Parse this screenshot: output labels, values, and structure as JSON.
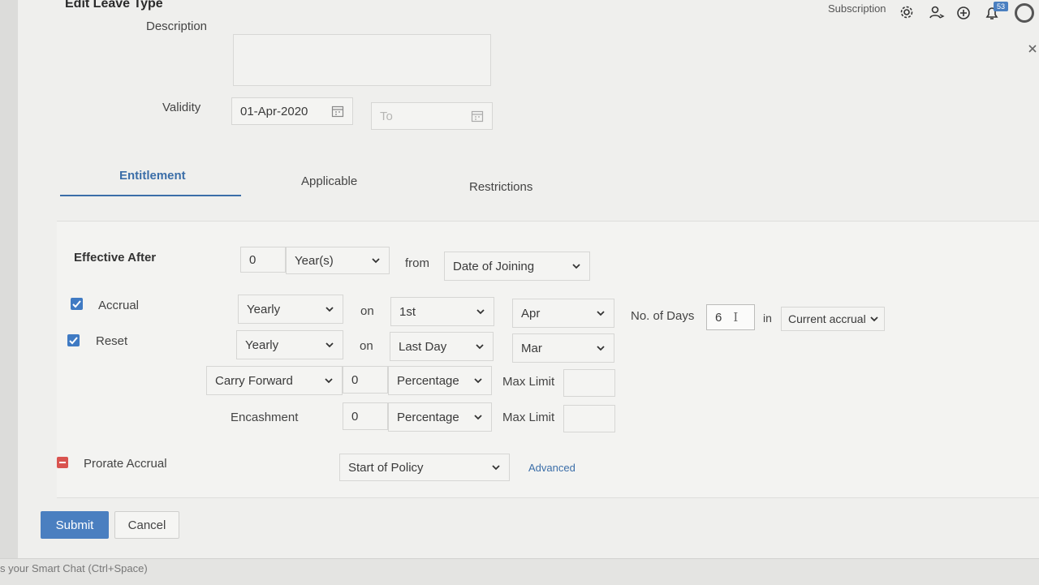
{
  "header": {
    "title": "Edit Leave Type",
    "subscription_label": "Subscription",
    "notification_count": "53"
  },
  "form": {
    "description_label": "Description",
    "validity_label": "Validity",
    "validity_from": "01-Apr-2020",
    "validity_to_placeholder": "To"
  },
  "tabs": [
    {
      "label": "Entitlement",
      "active": true
    },
    {
      "label": "Applicable",
      "active": false
    },
    {
      "label": "Restrictions",
      "active": false
    }
  ],
  "entitlement": {
    "effective_after": {
      "label": "Effective After",
      "value": "0",
      "unit": "Year(s)",
      "from_label": "from",
      "from_value": "Date of Joining"
    },
    "accrual": {
      "label": "Accrual",
      "checked": true,
      "frequency": "Yearly",
      "on_label": "on",
      "day": "1st",
      "month": "Apr",
      "days_label": "No. of Days",
      "days_value": "6",
      "in_label": "in",
      "in_value": "Current accrual"
    },
    "reset": {
      "label": "Reset",
      "checked": true,
      "frequency": "Yearly",
      "on_label": "on",
      "day": "Last Day",
      "month": "Mar"
    },
    "carry_forward": {
      "label": "Carry Forward",
      "value": "0",
      "type": "Percentage",
      "max_limit_label": "Max Limit",
      "max_limit_value": ""
    },
    "encashment": {
      "label": "Encashment",
      "value": "0",
      "type": "Percentage",
      "max_limit_label": "Max Limit",
      "max_limit_value": ""
    },
    "prorate": {
      "label": "Prorate Accrual",
      "value": "Start of Policy",
      "advanced_label": "Advanced"
    }
  },
  "actions": {
    "submit_label": "Submit",
    "cancel_label": "Cancel"
  },
  "footer": {
    "smart_chat_text": "s your Smart Chat (Ctrl+Space)"
  },
  "colors": {
    "accent": "#3f7ac3",
    "submit_bg": "#4a7fc0",
    "tab_active": "#3b6ea8",
    "minus_red": "#d9534f"
  }
}
